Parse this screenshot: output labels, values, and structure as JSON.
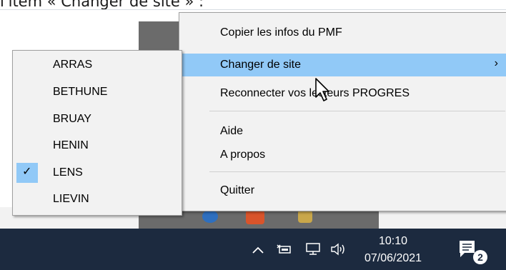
{
  "caption": "l'item « Changer de site » :",
  "main_menu": {
    "items": [
      {
        "label": "Copier les infos du PMF"
      },
      {
        "label": "Changer de site"
      },
      {
        "label": "Reconnecter vos lecteurs PROGRES"
      },
      {
        "label": "Aide"
      },
      {
        "label": "A propos"
      },
      {
        "label": "Quitter"
      }
    ],
    "submenu_arrow": "›"
  },
  "site_menu": {
    "items": [
      {
        "label": "ARRAS"
      },
      {
        "label": "BETHUNE"
      },
      {
        "label": "BRUAY"
      },
      {
        "label": "HENIN"
      },
      {
        "label": "LENS",
        "checked": true
      },
      {
        "label": "LIEVIN"
      }
    ],
    "check_mark": "✓"
  },
  "taskbar": {
    "time": "10:10",
    "date": "07/06/2021",
    "notification_count": "2"
  },
  "colors": {
    "highlight": "#91c9f7",
    "menu_bg": "#f2f2f2",
    "taskbar_bg": "#1c2a3f"
  }
}
